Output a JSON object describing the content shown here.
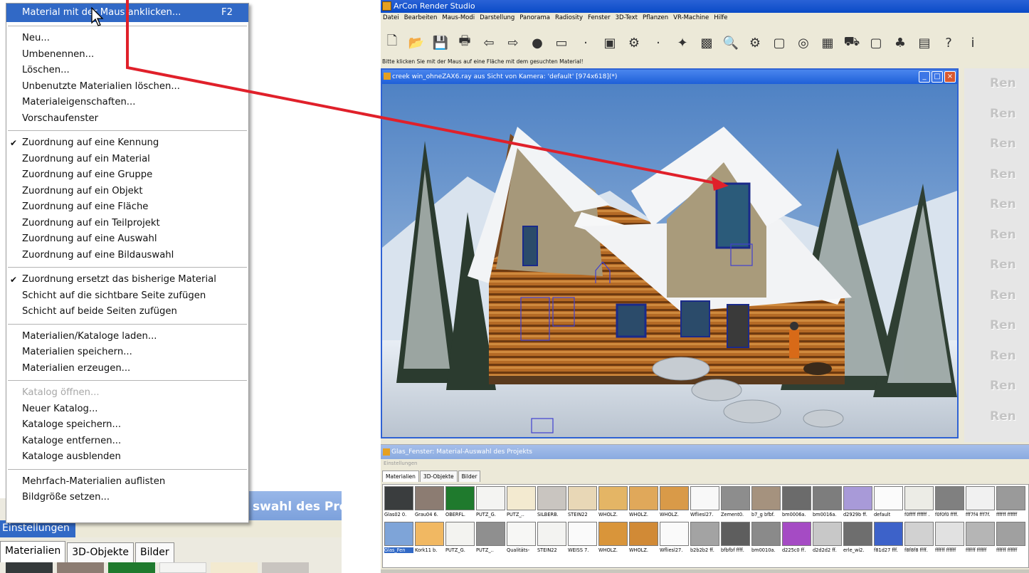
{
  "menu": {
    "items": [
      {
        "label": "Material mit der Maus anklicken...",
        "shortcut": "F2",
        "highlight": true
      },
      {
        "sep": true
      },
      {
        "label": "Neu..."
      },
      {
        "label": "Umbenennen..."
      },
      {
        "label": "Löschen..."
      },
      {
        "label": "Unbenutzte Materialien löschen..."
      },
      {
        "label": "Materialeigenschaften..."
      },
      {
        "label": "Vorschaufenster"
      },
      {
        "sep": true
      },
      {
        "label": "Zuordnung auf eine Kennung",
        "checked": true
      },
      {
        "label": "Zuordnung auf ein Material"
      },
      {
        "label": "Zuordnung auf eine Gruppe"
      },
      {
        "label": "Zuordnung auf ein Objekt"
      },
      {
        "label": "Zuordnung auf eine Fläche"
      },
      {
        "label": "Zuordnung auf ein Teilprojekt"
      },
      {
        "label": "Zuordnung auf eine Auswahl"
      },
      {
        "label": "Zuordnung auf eine Bildauswahl"
      },
      {
        "sep": true
      },
      {
        "label": "Zuordnung ersetzt das bisherige Material",
        "checked": true
      },
      {
        "label": "Schicht auf die sichtbare Seite zufügen"
      },
      {
        "label": "Schicht auf beide Seiten zufügen"
      },
      {
        "sep": true
      },
      {
        "label": "Materialien/Kataloge laden..."
      },
      {
        "label": "Materialien speichern..."
      },
      {
        "label": "Materialien erzeugen..."
      },
      {
        "sep": true
      },
      {
        "label": "Katalog öffnen...",
        "disabled": true
      },
      {
        "label": "Neuer Katalog..."
      },
      {
        "label": "Kataloge speichern..."
      },
      {
        "label": "Kataloge entfernen..."
      },
      {
        "label": "Kataloge ausblenden"
      },
      {
        "sep": true
      },
      {
        "label": "Mehrfach-Materialien auflisten"
      },
      {
        "label": "Bildgröße setzen..."
      }
    ]
  },
  "left_zoom": {
    "title_fragment": "swahl des Proje",
    "settings_label": "Einstellungen",
    "tabs": [
      "Materialien",
      "3D-Objekte",
      "Bilder"
    ]
  },
  "app": {
    "title": "ArCon Render Studio",
    "menu": [
      "Datei",
      "Bearbeiten",
      "Maus-Modi",
      "Darstellung",
      "Panorama",
      "Radiosity",
      "Fenster",
      "3D-Text",
      "Pflanzen",
      "VR-Machine",
      "Hilfe"
    ],
    "toolbar_icons": [
      "new-icon",
      "open-icon",
      "save-icon",
      "print-icon",
      "arrow-left-icon",
      "arrow-right-icon",
      "stop-icon",
      "window-icon",
      "dot-icon",
      "image-icon",
      "camera-icon",
      "dot-icon",
      "light-icon",
      "texture-icon",
      "magnifier-icon",
      "camera2-icon",
      "frame-icon",
      "globe-icon",
      "calculator-icon",
      "car-icon",
      "monitor-icon",
      "tree-icon",
      "book-icon",
      "help-icon",
      "info-icon"
    ],
    "toolbar_glyphs": [
      "🗋",
      "📂",
      "💾",
      "🖶",
      "⇦",
      "⇨",
      "●",
      "▭",
      "·",
      "▣",
      "⚙",
      "·",
      "✦",
      "▩",
      "🔍",
      "⚙",
      "▢",
      "◎",
      "▦",
      "⛟",
      "▢",
      "♣",
      "▤",
      "?",
      "i"
    ],
    "hint": "Bitte klicken Sie mit der Maus auf eine Fläche mit dem gesuchten Material!",
    "viewport_title": "creek win_ohneZAX6.ray aus Sicht von Kamera: 'default' [974x618](*)",
    "render_labels": [
      "Ren",
      "Ren",
      "Ren",
      "Ren",
      "Ren",
      "Ren",
      "Ren",
      "Ren",
      "Ren",
      "Ren",
      "Ren",
      "Ren"
    ],
    "material_window_title": "Glas_Fenster: Material-Auswahl des Projekts",
    "material_menu": "Einstellungen",
    "material_tabs": [
      "Materialien",
      "3D-Objekte",
      "Bilder"
    ],
    "swatch_row1_colors": [
      "#3a3d3e",
      "#8c7c72",
      "#1f7a2d",
      "#f4f4f2",
      "#f3ead0",
      "#c9c5c0",
      "#e8d7b6",
      "#e4b565",
      "#e0a85a",
      "#d99a48",
      "#f8f8f8",
      "#8d8d8d",
      "#a5927e",
      "#6b6b6b",
      "#7d7d7d",
      "#a89ad8",
      "#fbfbfb",
      "#ecece6",
      "#808080",
      "#f1f1f1",
      "#9a9a9a"
    ],
    "swatch_row1_labels": [
      "Glas02 0.",
      "Grau04 6.",
      "OBERFL.",
      "PUTZ_G.",
      "PUTZ_..",
      "SILBERB.",
      "STEIN22",
      "WHOLZ.",
      "WHOLZ.",
      "WHOLZ.",
      "Wfliesl27.",
      "Zement0.",
      "b7_g bfbf.",
      "bm0006a.",
      "bm0016a.",
      "d2929b ff.",
      "default",
      "f0ffff ffffff .",
      "f0f0f0 ffff.",
      "fff7f4 fff7f.",
      "ffffff ffffff"
    ],
    "swatch_row2_colors": [
      "#7ea4d8",
      "#f1b862",
      "#f3f3f0",
      "#8f8f8f",
      "#f7f7f5",
      "#f3f3f1",
      "#fafafa",
      "#d9953a",
      "#d18a36",
      "#fafafa",
      "#a3a3a3",
      "#5e5e5e",
      "#8a8a8a",
      "#a54bc4",
      "#c8c8c8",
      "#6e6e6e",
      "#3d62c9",
      "#d1d1d1",
      "#e1e1e1",
      "#b5b5b5",
      "#a0a0a0"
    ],
    "swatch_row2_labels": [
      "Glas_Fen",
      "Kork11 b.",
      "PUTZ_G.",
      "PUTZ_..",
      "Qualitäts-",
      "STEIN22",
      "WEISS 7.",
      "WHOLZ.",
      "WHOLZ.",
      "Wfliesl27.",
      "b2b2b2 ff.",
      "bfbfbf ffff.",
      "bm0010a.",
      "d225c0 ff.",
      "d2d2d2 ff.",
      "erle_wi2.",
      "f81d27 fff.",
      "f8f8f8 ffff.",
      "ffffff ffffff",
      "ffffff ffffff",
      "ffffff ffffff"
    ]
  }
}
